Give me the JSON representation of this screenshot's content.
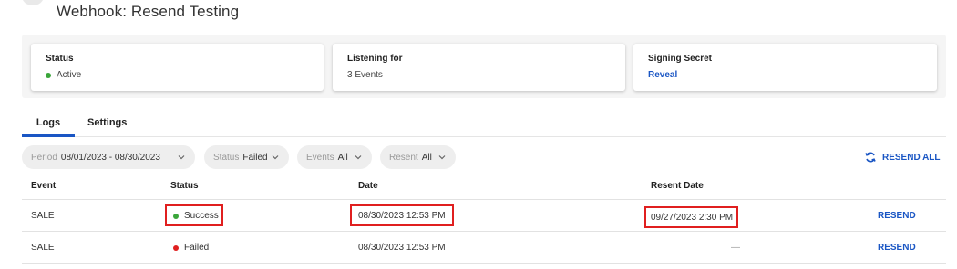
{
  "header": {
    "title": "Webhook: Resend Testing"
  },
  "cards": [
    {
      "label": "Status",
      "value": "Active",
      "dot_color": "#3aa63a"
    },
    {
      "label": "Listening for",
      "value": "3 Events"
    },
    {
      "label": "Signing Secret",
      "link": "Reveal"
    }
  ],
  "tabs": [
    {
      "label": "Logs",
      "active": true
    },
    {
      "label": "Settings",
      "active": false
    }
  ],
  "filters": [
    {
      "key": "Period",
      "value": "08/01/2023 - 08/30/2023"
    },
    {
      "key": "Status",
      "value": "Failed"
    },
    {
      "key": "Events",
      "value": "All"
    },
    {
      "key": "Resent",
      "value": "All"
    }
  ],
  "resend_all": {
    "label": "RESEND ALL",
    "icon": "refresh-icon"
  },
  "table": {
    "columns": [
      "Event",
      "Status",
      "Date",
      "Resent Date"
    ],
    "rows": [
      {
        "event": "SALE",
        "status": "Success",
        "status_color": "#3aa63a",
        "date": "08/30/2023 12:53 PM",
        "resent_date": "09/27/2023 2:30 PM",
        "action": "RESEND"
      },
      {
        "event": "SALE",
        "status": "Failed",
        "status_color": "#e01f1f",
        "date": "08/30/2023 12:53 PM",
        "resent_date": "—",
        "action": "RESEND"
      }
    ]
  },
  "colors": {
    "accent": "#1a56c4",
    "highlight": "#e01f1f",
    "success": "#3aa63a",
    "failed": "#e01f1f"
  }
}
